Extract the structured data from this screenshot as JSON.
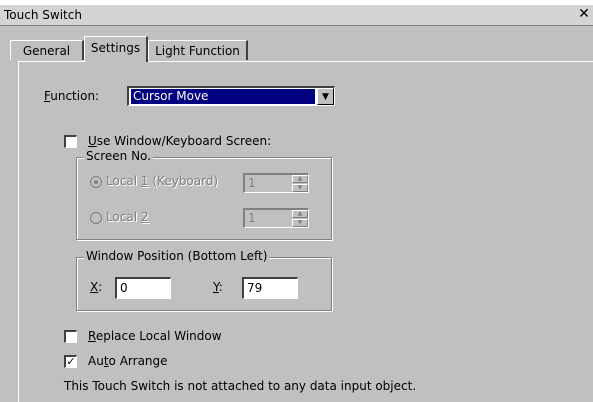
{
  "window": {
    "title": "Touch Switch",
    "close_glyph": "✕"
  },
  "tabs": [
    {
      "label": "General",
      "active": false
    },
    {
      "label": "Settings",
      "active": true
    },
    {
      "label": "Light Function",
      "active": false
    }
  ],
  "function": {
    "label_first": "F",
    "label_rest": "unction:",
    "selected": "Cursor Move",
    "arrow_glyph": "▼"
  },
  "use_window": {
    "checked": false,
    "label_first": "U",
    "label_rest": "se Window/Keyboard Screen:"
  },
  "screen_no": {
    "title": "Screen No.",
    "local1": {
      "label_prefix": "Local ",
      "label_key": "1",
      "label_suffix": " (Keyboard)",
      "value": "1",
      "selected": true
    },
    "local2": {
      "label_prefix": "Local ",
      "label_key": "2",
      "label_suffix": "",
      "value": "1",
      "selected": false
    },
    "up_glyph": "▲",
    "down_glyph": "▼"
  },
  "window_position": {
    "title": "Window Position (Bottom Left)",
    "x_label_key": "X",
    "x_label_rest": ":",
    "x_value": "0",
    "y_label_key": "Y",
    "y_label_rest": ":",
    "y_value": "79"
  },
  "replace_local_window": {
    "checked": false,
    "label_first": "R",
    "label_rest": "eplace Local Window"
  },
  "auto_arrange": {
    "checked": true,
    "check_glyph": "✓",
    "label_pre": "Au",
    "label_key": "t",
    "label_rest": "o Arrange"
  },
  "status_text": "This Touch Switch is not attached to any data input object."
}
